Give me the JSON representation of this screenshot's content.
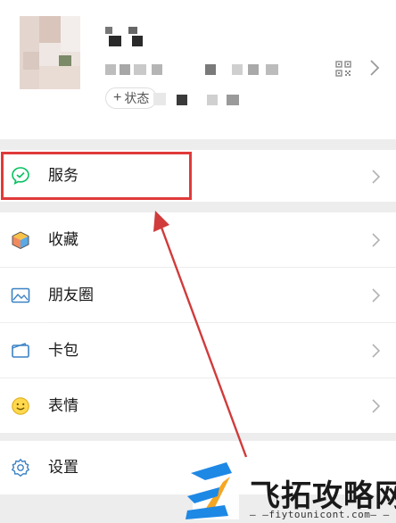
{
  "profile": {
    "status_label": "状态"
  },
  "menu": {
    "services": "服务",
    "favorites": "收藏",
    "moments": "朋友圈",
    "cards": "卡包",
    "stickers": "表情",
    "settings": "设置"
  },
  "watermark": {
    "text": "飞拓攻略网",
    "url": "— —fiytounicont.com— —"
  },
  "colors": {
    "accent_green": "#07c160",
    "highlight_red": "#e03a3a",
    "watermark_blue": "#1e88e5",
    "watermark_orange": "#f5a623"
  }
}
